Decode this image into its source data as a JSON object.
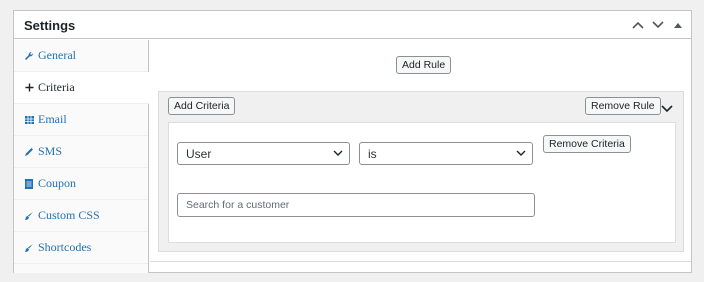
{
  "panel": {
    "title": "Settings",
    "controls": [
      {
        "icon": "chevron-up-icon"
      },
      {
        "icon": "chevron-down-icon"
      },
      {
        "icon": "triangle-up-icon"
      }
    ]
  },
  "sidebar": {
    "items": [
      {
        "label": "General",
        "icon": "wrench-icon",
        "active": false
      },
      {
        "label": "Criteria",
        "icon": "plus-icon",
        "active": true
      },
      {
        "label": "Email",
        "icon": "table-icon",
        "active": false
      },
      {
        "label": "SMS",
        "icon": "pencil-icon",
        "active": false
      },
      {
        "label": "Coupon",
        "icon": "document-icon",
        "active": false
      },
      {
        "label": "Custom CSS",
        "icon": "brush-icon",
        "active": false
      },
      {
        "label": "Shortcodes",
        "icon": "brush-icon",
        "active": false
      }
    ]
  },
  "main": {
    "add_rule_label": "Add Rule",
    "rule": {
      "add_criteria_label": "Add Criteria",
      "remove_rule_label": "Remove Rule",
      "criteria": {
        "field_value": "User",
        "operator_value": "is",
        "remove_criteria_label": "Remove Criteria",
        "search_placeholder": "Search for a customer"
      }
    }
  },
  "colors": {
    "link": "#2271b1",
    "border": "#c3c4c7",
    "background": "#f0f0f1"
  }
}
